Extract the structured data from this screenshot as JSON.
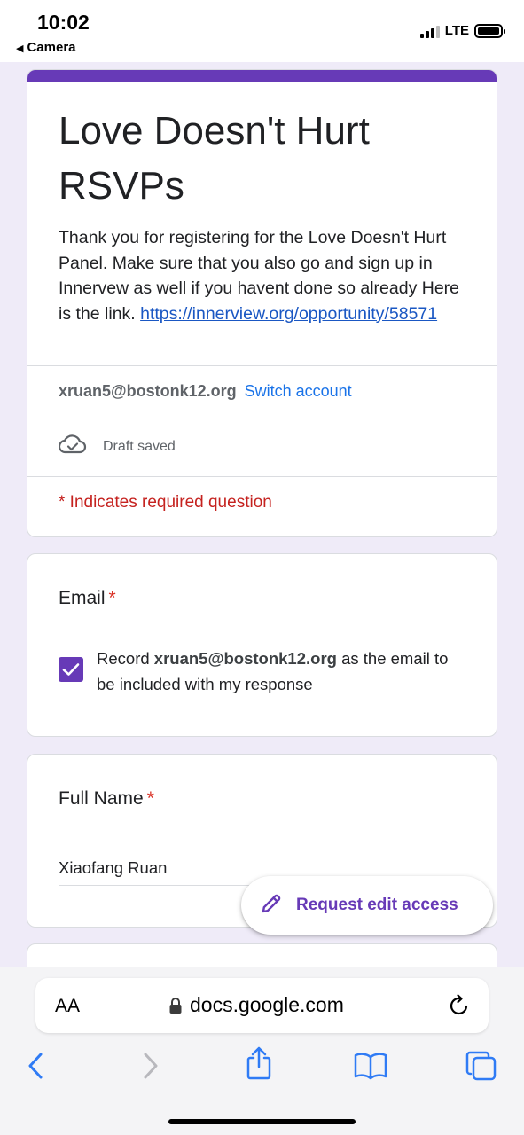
{
  "status_bar": {
    "time": "10:02",
    "back_app": "Camera",
    "network": "LTE"
  },
  "form": {
    "title": "Love Doesn't Hurt RSVPs",
    "description": "Thank you for registering for the Love Doesn't Hurt Panel.  Make sure that you also go and sign up in Innervew as well if you havent done so already Here is the link.",
    "link_text": "https://innerview.org/opportunity/58571",
    "accent_color": "#673ab7"
  },
  "account": {
    "email": "xruan5@bostonk12.org",
    "switch_label": "Switch account",
    "draft_status": "Draft saved",
    "draft_icon": "cloud-check-icon"
  },
  "required_note": "* Indicates required question",
  "questions": {
    "email": {
      "title": "Email",
      "required_mark": "*",
      "checkbox_checked": true,
      "record_prefix": "Record",
      "record_email": "xruan5@bostonk12.org",
      "record_suffix": "as the email to be included with my response"
    },
    "full_name": {
      "title": "Full Name",
      "required_mark": "*",
      "value": "Xiaofang Ruan"
    }
  },
  "fab": {
    "label": "Request edit access",
    "icon": "pencil-icon"
  },
  "safari": {
    "text_size_label": "AA",
    "url": "docs.google.com",
    "icons": [
      "back-icon",
      "forward-icon",
      "share-icon",
      "bookmarks-icon",
      "tabs-icon"
    ]
  }
}
